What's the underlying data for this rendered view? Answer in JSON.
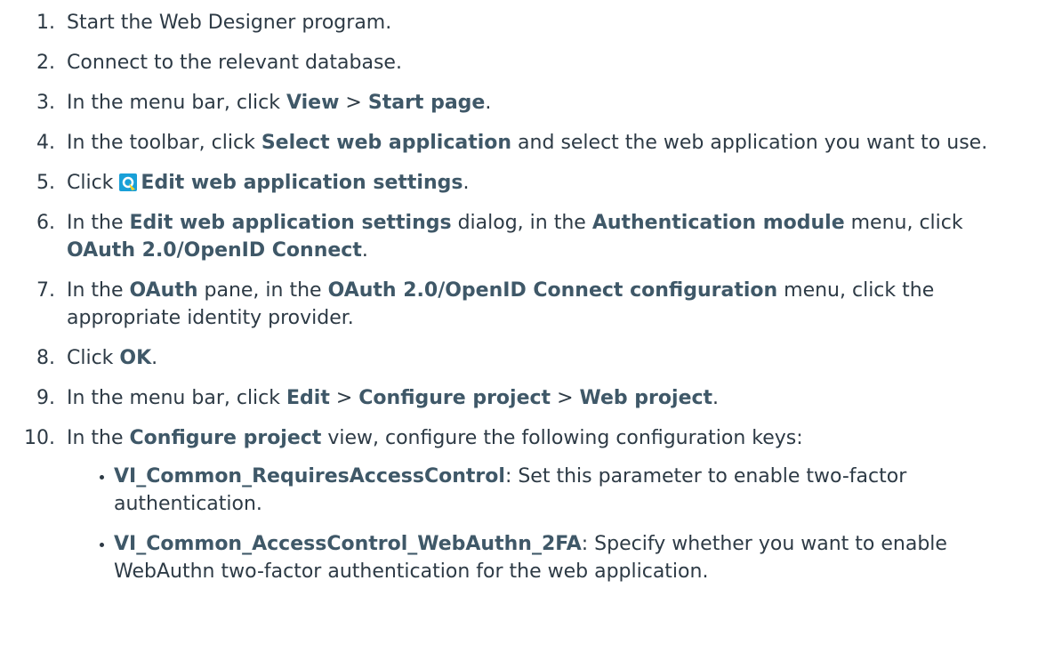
{
  "steps": [
    {
      "num": "1.",
      "parts": [
        {
          "t": "Start the Web Designer program."
        }
      ]
    },
    {
      "num": "2.",
      "parts": [
        {
          "t": "Connect to the relevant database."
        }
      ]
    },
    {
      "num": "3.",
      "parts": [
        {
          "t": "In the menu bar, click "
        },
        {
          "b": "View"
        },
        {
          "t": " > "
        },
        {
          "b": "Start page"
        },
        {
          "t": "."
        }
      ]
    },
    {
      "num": "4.",
      "parts": [
        {
          "t": "In the toolbar, click "
        },
        {
          "b": "Select web application"
        },
        {
          "t": " and select the web application you want to use."
        }
      ]
    },
    {
      "num": "5.",
      "parts": [
        {
          "t": "Click "
        },
        {
          "icon": "settings-icon"
        },
        {
          "b": "Edit web application settings"
        },
        {
          "t": "."
        }
      ]
    },
    {
      "num": "6.",
      "parts": [
        {
          "t": "In the "
        },
        {
          "b": "Edit web application settings"
        },
        {
          "t": " dialog, in the "
        },
        {
          "b": "Authentication module"
        },
        {
          "t": " menu, click "
        },
        {
          "b": "OAuth 2.0/OpenID Connect"
        },
        {
          "t": "."
        }
      ]
    },
    {
      "num": "7.",
      "parts": [
        {
          "t": "In the "
        },
        {
          "b": "OAuth"
        },
        {
          "t": " pane, in the "
        },
        {
          "b": "OAuth 2.0/OpenID Connect configuration"
        },
        {
          "t": " menu, click the appropriate identity provider."
        }
      ]
    },
    {
      "num": "8.",
      "parts": [
        {
          "t": "Click "
        },
        {
          "b": "OK"
        },
        {
          "t": "."
        }
      ]
    },
    {
      "num": "9.",
      "parts": [
        {
          "t": "In the menu bar, click "
        },
        {
          "b": "Edit"
        },
        {
          "t": " > "
        },
        {
          "b": "Configure project"
        },
        {
          "t": " > "
        },
        {
          "b": "Web project"
        },
        {
          "t": "."
        }
      ]
    },
    {
      "num": "10.",
      "parts": [
        {
          "t": "In the "
        },
        {
          "b": "Configure project"
        },
        {
          "t": " view, configure the following configuration keys:"
        }
      ],
      "bullets": [
        [
          {
            "b": "VI_Common_RequiresAccessControl"
          },
          {
            "t": ": Set this parameter to enable two-factor authentication."
          }
        ],
        [
          {
            "b": "VI_Common_AccessControl_WebAuthn_2FA"
          },
          {
            "t": ": Specify whether you want to enable WebAuthn two-factor authentication for the web application."
          }
        ]
      ]
    }
  ],
  "colors": {
    "text": "#2d3a45",
    "bold": "#3f5868",
    "icon_bg": "#19a0d8",
    "icon_fg": "#f5d327"
  }
}
